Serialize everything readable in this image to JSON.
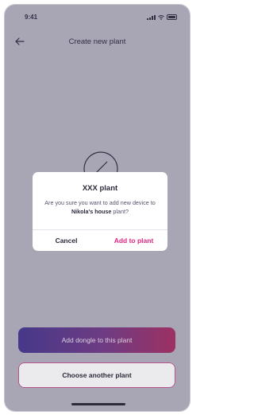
{
  "status_bar": {
    "time": "9:41"
  },
  "nav": {
    "title": "Create new plant"
  },
  "dialog": {
    "title": "XXX plant",
    "message_before": "Are you sure you want to add new device to ",
    "message_bold": "Nikola's house",
    "message_after": " plant?",
    "cancel_label": "Cancel",
    "confirm_label": "Add to plant"
  },
  "actions": {
    "primary_label": "Add dongle to this plant",
    "secondary_label": "Choose another plant"
  },
  "colors": {
    "accent": "#e0247f",
    "gradient_start": "#4b3aa6",
    "gradient_end": "#d02f6a",
    "text": "#2d2a3b"
  }
}
